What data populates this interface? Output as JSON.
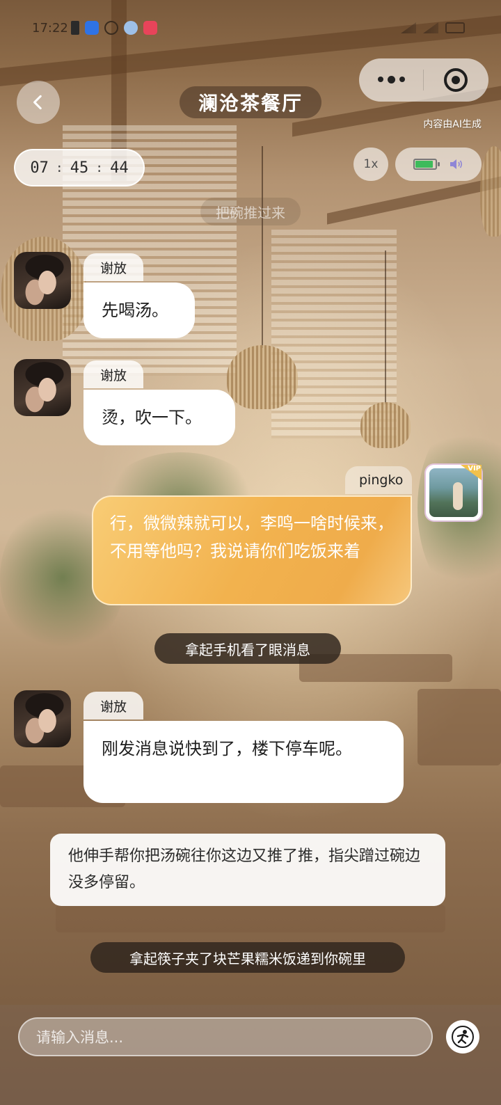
{
  "status_bar": {
    "time": "17:22"
  },
  "header": {
    "title": "澜沧茶餐厅",
    "ai_note": "内容由AI生成"
  },
  "toolbar": {
    "timer": [
      "07",
      "45",
      "44"
    ],
    "timer_sep": ":",
    "speed": "1x",
    "battery_level": 0.9
  },
  "chat": {
    "faint_narration": "把碗推过来",
    "messages": [
      {
        "sender": "谢放",
        "text": "先喝汤。"
      },
      {
        "sender": "谢放",
        "text": "烫，吹一下。"
      },
      {
        "sender": "pingko",
        "text": "行，微微辣就可以，李鸣一啥时候来，不用等他吗？我说请你们吃饭来着"
      },
      {
        "narration": "拿起手机看了眼消息"
      },
      {
        "sender": "谢放",
        "text": "刚发消息说快到了，楼下停车呢。"
      },
      {
        "narration_box": "他伸手帮你把汤碗往你这边又推了推，指尖蹭过碗边没多停留。"
      },
      {
        "narration": "拿起筷子夹了块芒果糯米饭递到你碗里"
      }
    ],
    "user_badge": "VIP"
  },
  "input": {
    "placeholder": "请输入消息..."
  },
  "colors": {
    "user_bubble": "#f2b24e",
    "bot_bubble": "#ffffff",
    "narration_dark": "#2d231c"
  }
}
